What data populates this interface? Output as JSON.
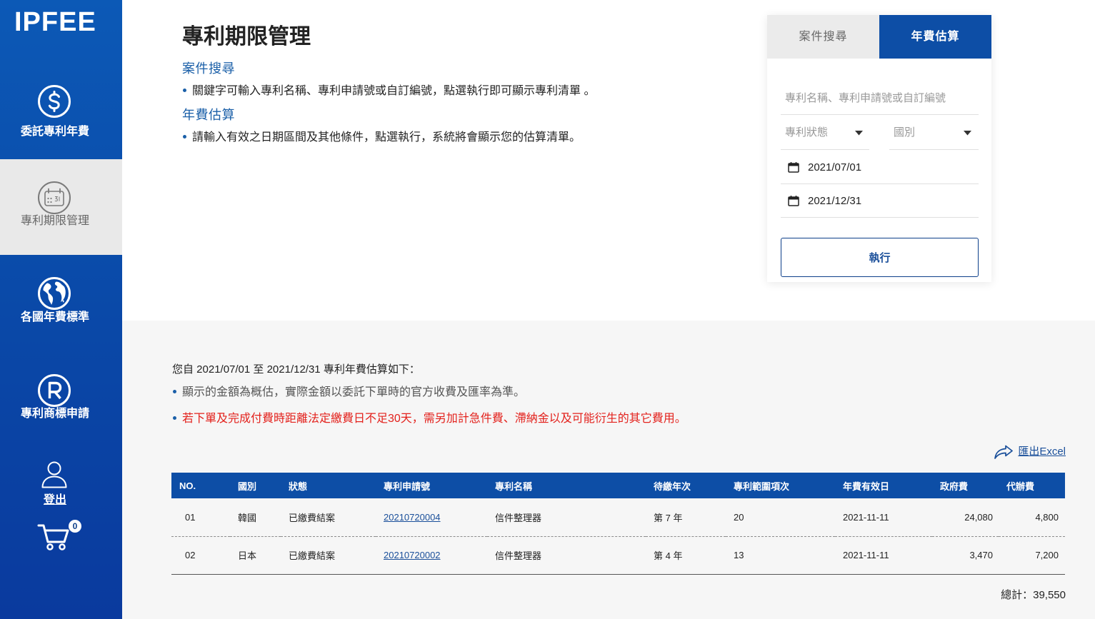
{
  "brand": {
    "logo": "IPFEE"
  },
  "colors": {
    "primary": "#0d4ea6",
    "sidebar_top": "#0c59b6",
    "sidebar_bottom": "#0a3a9e",
    "active_nav_bg": "#e9e9e9",
    "link": "#1a4f9a",
    "heading_blue": "#1a5fa8",
    "warning": "#e3211c",
    "results_bg": "#f6f6f6"
  },
  "sidebar": {
    "items": [
      {
        "label": "委託專利年費",
        "icon": "dollar-circle-icon",
        "active": false
      },
      {
        "label": "專利期限管理",
        "icon": "calendar-circle-icon",
        "active": true
      },
      {
        "label": "各國年費標準",
        "icon": "globe-icon",
        "active": false
      },
      {
        "label": "專利商標申請",
        "icon": "registered-trademark-icon",
        "active": false
      }
    ],
    "logout": {
      "label": "登出",
      "icon": "user-icon"
    },
    "cart": {
      "icon": "cart-icon",
      "count": "0"
    }
  },
  "intro": {
    "title": "專利期限管理",
    "sections": [
      {
        "heading": "案件搜尋",
        "text": "關鍵字可輸入專利名稱、專利申請號或自訂編號，點選執行即可顯示專利清單 。"
      },
      {
        "heading": "年費估算",
        "text": "請輸入有效之日期區間及其他條件，點選執行，系統將會顯示您的估算清單。"
      }
    ]
  },
  "search_panel": {
    "tabs": [
      {
        "label": "案件搜尋",
        "active": false
      },
      {
        "label": "年費估算",
        "active": true
      }
    ],
    "keyword": {
      "placeholder": "專利名稱、專利申請號或自訂編號",
      "value": ""
    },
    "status_select": {
      "selected": "專利狀態",
      "icon": "caret-down-icon"
    },
    "country_select": {
      "selected": "國別",
      "icon": "caret-down-icon"
    },
    "start_date": {
      "value": "2021/07/01",
      "icon": "calendar-icon"
    },
    "end_date": {
      "value": "2021/12/31",
      "icon": "calendar-icon"
    },
    "submit_label": "執行"
  },
  "results": {
    "summary": "您自 2021/07/01 至 2021/12/31 專利年費估算如下：",
    "notes": [
      "顯示的金額為概估，實際金額以委託下單時的官方收費及匯率為準。",
      "若下單及完成付費時距離法定繳費日不足30天，需另加計急件費、滯納金以及可能衍生的其它費用。"
    ],
    "export": {
      "label": "匯出Excel",
      "icon": "share-arrow-icon"
    },
    "columns": [
      "NO.",
      "國別",
      "狀態",
      "專利申請號",
      "專利名稱",
      "待繳年次",
      "專利範圍項次",
      "年費有效日",
      "政府費",
      "代辦費"
    ],
    "rows": [
      {
        "no": "01",
        "country": "韓國",
        "status": "已繳費結案",
        "application_no": "20210720004",
        "name": "信件整理器",
        "year": "第 7 年",
        "claims": "20",
        "due_date": "2021-11-11",
        "gov_fee": "24,080",
        "agent_fee": "4,800"
      },
      {
        "no": "02",
        "country": "日本",
        "status": "已繳費結案",
        "application_no": "20210720002",
        "name": "信件整理器",
        "year": "第 4 年",
        "claims": "13",
        "due_date": "2021-11-11",
        "gov_fee": "3,470",
        "agent_fee": "7,200"
      }
    ],
    "total_label": "總計：",
    "total_value": "39,550"
  }
}
